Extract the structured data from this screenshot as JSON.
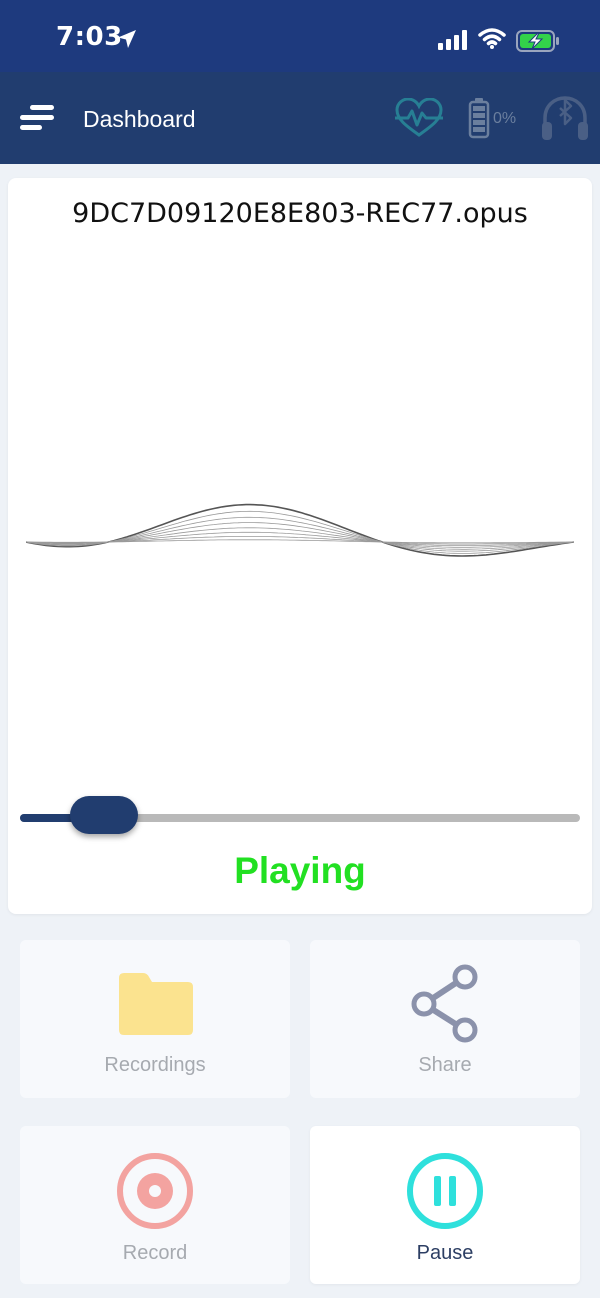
{
  "status_bar": {
    "time": "7:03"
  },
  "nav": {
    "title": "Dashboard",
    "battery_percent": "0%"
  },
  "player": {
    "file_name": "9DC7D09120E8E803-REC77.opus",
    "status": "Playing",
    "progress": 0.15
  },
  "tiles": {
    "recordings": "Recordings",
    "share": "Share",
    "record": "Record",
    "pause": "Pause"
  },
  "colors": {
    "header": "#1e3a7e",
    "nav": "#213d6f",
    "playing": "#22e022",
    "folder": "#fbe38f",
    "share": "#8b92ab",
    "record": "#f3a3a0",
    "pause": "#2ee0dc"
  },
  "icons": {
    "location": "location-arrow-icon",
    "signal": "cellular-signal-icon",
    "wifi": "wifi-icon",
    "battery": "battery-charging-icon",
    "menu": "menu-icon",
    "heart": "heart-rate-icon",
    "device_battery": "battery-icon",
    "headphones": "bluetooth-headphones-icon",
    "folder": "folder-icon",
    "share": "share-icon",
    "record": "record-icon",
    "pause": "pause-icon"
  }
}
